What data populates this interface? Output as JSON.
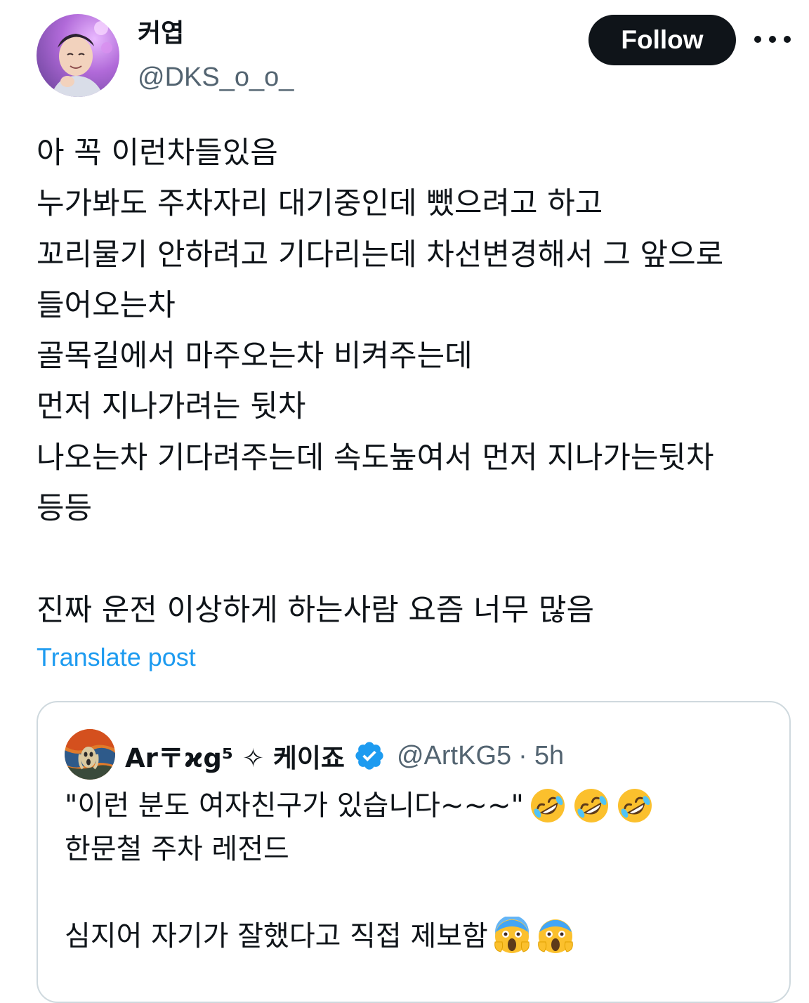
{
  "author": {
    "display_name": "커엽",
    "handle": "@DKS_o_o_"
  },
  "actions": {
    "follow_label": "Follow"
  },
  "post": {
    "lines": [
      "아 꼭 이런차들있음",
      "누가봐도 주차자리 대기중인데 뺐으려고 하고",
      "꼬리물기 안하려고 기다리는데 차선변경해서 그 앞으로",
      "들어오는차",
      "골목길에서 마주오는차 비켜주는데",
      "먼저 지나가려는 뒷차",
      "나오는차 기다려주는데 속도높여서 먼저 지나가는뒷차",
      "등등",
      "",
      "진짜 운전 이상하게 하는사람 요즘 너무 많음"
    ],
    "translate_label": "Translate post"
  },
  "quoted_post": {
    "display_name": "Ar〒ϰg⁵ ✧ 케이죠",
    "handle": "@ArtKG5",
    "separator": "·",
    "time": "5h",
    "line1": "\"이런 분도 여자친구가 있습니다~~~\"",
    "line2": "한문철 주차 레전드",
    "line3": "심지어 자기가 잘했다고 직접 제보함",
    "line1_emojis": [
      "rolling-on-floor-laughing",
      "rolling-on-floor-laughing",
      "rolling-on-floor-laughing"
    ],
    "line3_emojis": [
      "face-screaming-in-fear",
      "face-screaming-in-fear"
    ]
  },
  "colors": {
    "text": "#0f1419",
    "secondary": "#536471",
    "link": "#1d9bf0",
    "border": "#cfd9de",
    "follow_bg": "#0f1419"
  }
}
